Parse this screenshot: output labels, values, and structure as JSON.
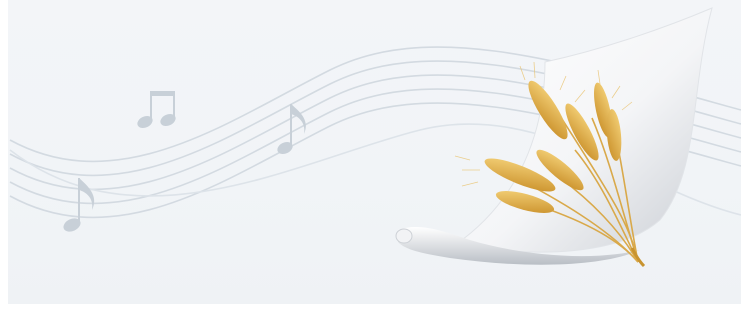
{
  "banner": {
    "background_color": "#f2f5f8",
    "staff_color": "#d2d9e0",
    "note_color": "#c7cfd7",
    "paper_color": "#ffffff",
    "wheat_color": "#e2b34a",
    "icons": [
      "music-staff-icon",
      "beamed-eighth-notes-icon",
      "eighth-note-icon",
      "curled-paper-icon",
      "wheat-bundle-icon"
    ]
  }
}
